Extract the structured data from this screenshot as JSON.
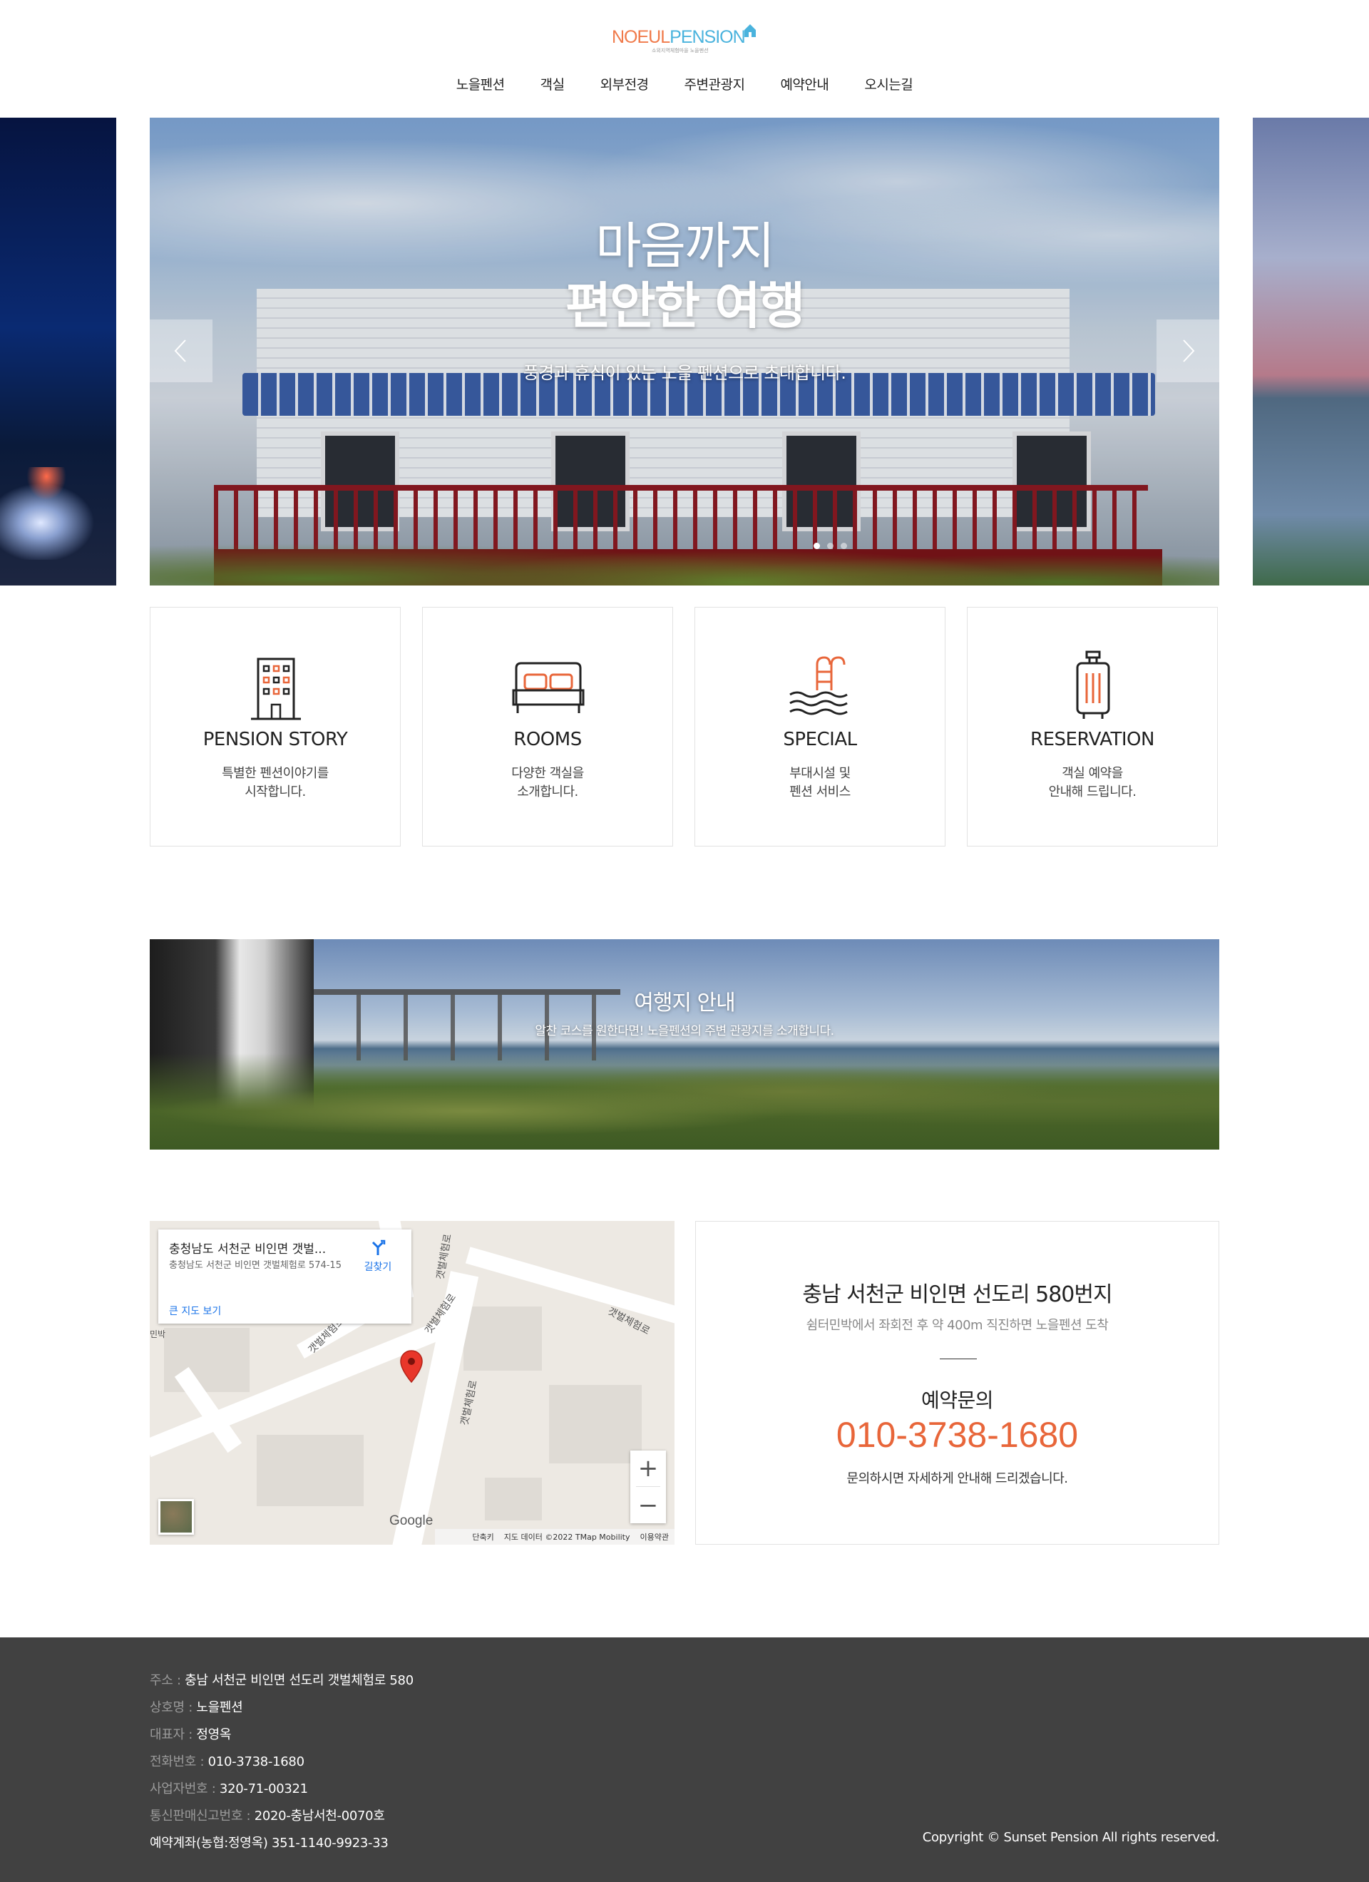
{
  "brand": {
    "logo_part1": "NOEUL",
    "logo_part2": "PENSION",
    "logo_sub": "소외지역체험마을 노을펜션"
  },
  "nav": {
    "items": [
      "노을펜션",
      "객실",
      "외부전경",
      "주변관광지",
      "예약안내",
      "오시는길"
    ]
  },
  "hero": {
    "line1": "마음까지",
    "line2": "편안한 여행",
    "line3": "풍경과 휴식이 있는 노을 펜션으로 초대합니다.",
    "total_slides": 3,
    "active_slide": 1
  },
  "features": [
    {
      "icon": "building-icon",
      "title": "PENSION STORY",
      "desc1": "특별한 펜션이야기를",
      "desc2": "시작합니다."
    },
    {
      "icon": "bed-icon",
      "title": "ROOMS",
      "desc1": "다양한 객실을",
      "desc2": "소개합니다."
    },
    {
      "icon": "pool-ladder-icon",
      "title": "SPECIAL",
      "desc1": "부대시설 및",
      "desc2": "펜션 서비스"
    },
    {
      "icon": "suitcase-icon",
      "title": "RESERVATION",
      "desc1": "객실 예약을",
      "desc2": "안내해 드립니다."
    }
  ],
  "travel": {
    "title": "여행지 안내",
    "subtitle": "알찬 코스를 원한다면! 노을펜션의 주변 관광지를 소개합니다."
  },
  "map": {
    "info_title": "충청남도 서천군 비인면 갯벌...",
    "info_addr": "충청남도 서천군 비인면 갯벌체험로 574-15",
    "big_map_link": "큰 지도 보기",
    "directions_label": "길찾기",
    "street_labels": [
      "갯벌체험로",
      "갯벌체험로",
      "갯벌체험로",
      "갯벌체험로",
      "갯벌체험로",
      "민박"
    ],
    "google_label": "Google",
    "shortcut_label": "단축키",
    "map_data_label": "지도 데이터 ©2022 TMap Mobility",
    "terms_label": "이용약관",
    "zoom_in": "+",
    "zoom_out": "−"
  },
  "contact": {
    "address": "충남 서천군 비인면 선도리 580번지",
    "directions": "쉼터민박에서 좌회전 후 약 400m 직진하면 노을펜션 도착",
    "title": "예약문의",
    "phone": "010-3738-1680",
    "note": "문의하시면 자세하게 안내해 드리겠습니다."
  },
  "footer": {
    "lines": [
      {
        "label": "주소 : ",
        "value": "충남 서천군 비인면 선도리 갯벌체험로 580"
      },
      {
        "label": "상호명 : ",
        "value": "노을펜션"
      },
      {
        "label": "대표자 : ",
        "value": "정영옥"
      },
      {
        "label": "전화번호 : ",
        "value": "010-3738-1680"
      },
      {
        "label": "사업자번호 : ",
        "value": "320-71-00321"
      },
      {
        "label": "통신판매신고번호 : ",
        "value": "2020-충남서천-0070호"
      }
    ],
    "bank": "예약계좌(농협:정영옥) 351-1140-9923-33",
    "copyright": "Copyright © Sunset Pension All rights reserved."
  },
  "colors": {
    "accent_orange": "#e8663a",
    "logo_blue": "#4ab3dd",
    "footer_bg": "#414141"
  }
}
